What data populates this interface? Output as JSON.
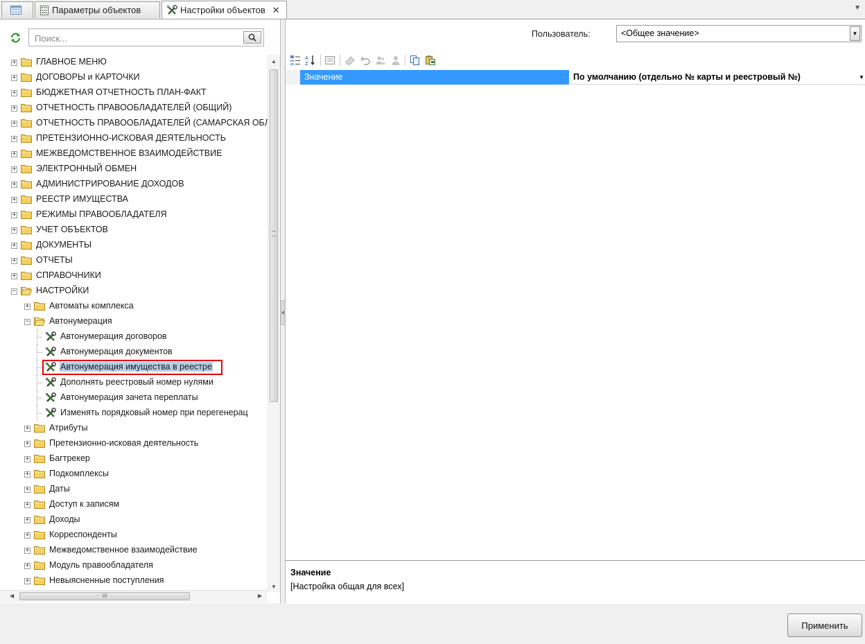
{
  "tabs": [
    {
      "label": "",
      "icon": "window-icon"
    },
    {
      "label": "Параметры объектов",
      "icon": "form-icon"
    },
    {
      "label": "Настройки объектов",
      "icon": "tools-icon",
      "active": true
    }
  ],
  "search": {
    "placeholder": "Поиск..."
  },
  "tree": [
    {
      "label": "ГЛАВНОЕ МЕНЮ",
      "level": 0,
      "type": "folder",
      "expander": "+"
    },
    {
      "label": "ДОГОВОРЫ и КАРТОЧКИ",
      "level": 0,
      "type": "folder",
      "expander": "+"
    },
    {
      "label": "БЮДЖЕТНАЯ ОТЧЕТНОСТЬ ПЛАН-ФАКТ",
      "level": 0,
      "type": "folder",
      "expander": "+"
    },
    {
      "label": "ОТЧЕТНОСТЬ ПРАВООБЛАДАТЕЛЕЙ (ОБЩИЙ)",
      "level": 0,
      "type": "folder",
      "expander": "+"
    },
    {
      "label": "ОТЧЕТНОСТЬ ПРАВООБЛАДАТЕЛЕЙ (САМАРСКАЯ ОБЛ.",
      "level": 0,
      "type": "folder",
      "expander": "+"
    },
    {
      "label": "ПРЕТЕНЗИОННО-ИСКОВАЯ ДЕЯТЕЛЬНОСТЬ",
      "level": 0,
      "type": "folder",
      "expander": "+"
    },
    {
      "label": "МЕЖВЕДОМСТВЕННОЕ ВЗАИМОДЕЙСТВИЕ",
      "level": 0,
      "type": "folder",
      "expander": "+"
    },
    {
      "label": "ЭЛЕКТРОННЫЙ ОБМЕН",
      "level": 0,
      "type": "folder",
      "expander": "+"
    },
    {
      "label": "АДМИНИСТРИРОВАНИЕ ДОХОДОВ",
      "level": 0,
      "type": "folder",
      "expander": "+"
    },
    {
      "label": "РЕЕСТР ИМУЩЕСТВА",
      "level": 0,
      "type": "folder",
      "expander": "+"
    },
    {
      "label": "РЕЖИМЫ ПРАВООБЛАДАТЕЛЯ",
      "level": 0,
      "type": "folder",
      "expander": "+"
    },
    {
      "label": "УЧЕТ ОБЪЕКТОВ",
      "level": 0,
      "type": "folder",
      "expander": "+"
    },
    {
      "label": "ДОКУМЕНТЫ",
      "level": 0,
      "type": "folder",
      "expander": "+"
    },
    {
      "label": "ОТЧЕТЫ",
      "level": 0,
      "type": "folder",
      "expander": "+"
    },
    {
      "label": "СПРАВОЧНИКИ",
      "level": 0,
      "type": "folder",
      "expander": "+"
    },
    {
      "label": "НАСТРОЙКИ",
      "level": 0,
      "type": "folder-open",
      "expander": "-"
    },
    {
      "label": "Автоматы комплекса",
      "level": 1,
      "type": "folder",
      "expander": "+"
    },
    {
      "label": "Автонумерация",
      "level": 1,
      "type": "folder-open",
      "expander": "-"
    },
    {
      "label": "Автонумерация договоров",
      "level": 2,
      "type": "setting",
      "expander": ""
    },
    {
      "label": "Автонумерация документов",
      "level": 2,
      "type": "setting",
      "expander": ""
    },
    {
      "label": "Автонумерация имущества в реестре",
      "level": 2,
      "type": "setting",
      "expander": "",
      "selected": true
    },
    {
      "label": "Дополнять реестровый номер нулями",
      "level": 2,
      "type": "setting",
      "expander": ""
    },
    {
      "label": "Автонумерация зачета переплаты",
      "level": 2,
      "type": "setting",
      "expander": ""
    },
    {
      "label": "Изменять порядковый номер при перегенерац",
      "level": 2,
      "type": "setting",
      "expander": ""
    },
    {
      "label": "Атрибуты",
      "level": 1,
      "type": "folder",
      "expander": "+"
    },
    {
      "label": "Претензионно-исковая деятельность",
      "level": 1,
      "type": "folder",
      "expander": "+"
    },
    {
      "label": "Багтрекер",
      "level": 1,
      "type": "folder",
      "expander": "+"
    },
    {
      "label": "Подкомплексы",
      "level": 1,
      "type": "folder",
      "expander": "+"
    },
    {
      "label": "Даты",
      "level": 1,
      "type": "folder",
      "expander": "+"
    },
    {
      "label": "Доступ к записям",
      "level": 1,
      "type": "folder",
      "expander": "+"
    },
    {
      "label": "Доходы",
      "level": 1,
      "type": "folder",
      "expander": "+"
    },
    {
      "label": "Корреспонденты",
      "level": 1,
      "type": "folder",
      "expander": "+"
    },
    {
      "label": "Межведомственное взаимодействие",
      "level": 1,
      "type": "folder",
      "expander": "+"
    },
    {
      "label": "Модуль правообладателя",
      "level": 1,
      "type": "folder",
      "expander": "+"
    },
    {
      "label": "Невыясненные поступления",
      "level": 1,
      "type": "folder",
      "expander": "+"
    }
  ],
  "hscroll_grip": "III",
  "user": {
    "label": "Пользователь:",
    "value": "<Общее значение>"
  },
  "property": {
    "name": "Значение",
    "value": "По умолчанию (отдельно № карты и реестровый №)"
  },
  "description": {
    "title": "Значение",
    "text": "[Настройка общая для всех]"
  },
  "apply_label": "Применить",
  "colors": {
    "selection_bg": "#3399ff",
    "tree_selected_bg": "#b9cde5",
    "highlight_border": "#e00000",
    "folder": "#f4d060"
  }
}
